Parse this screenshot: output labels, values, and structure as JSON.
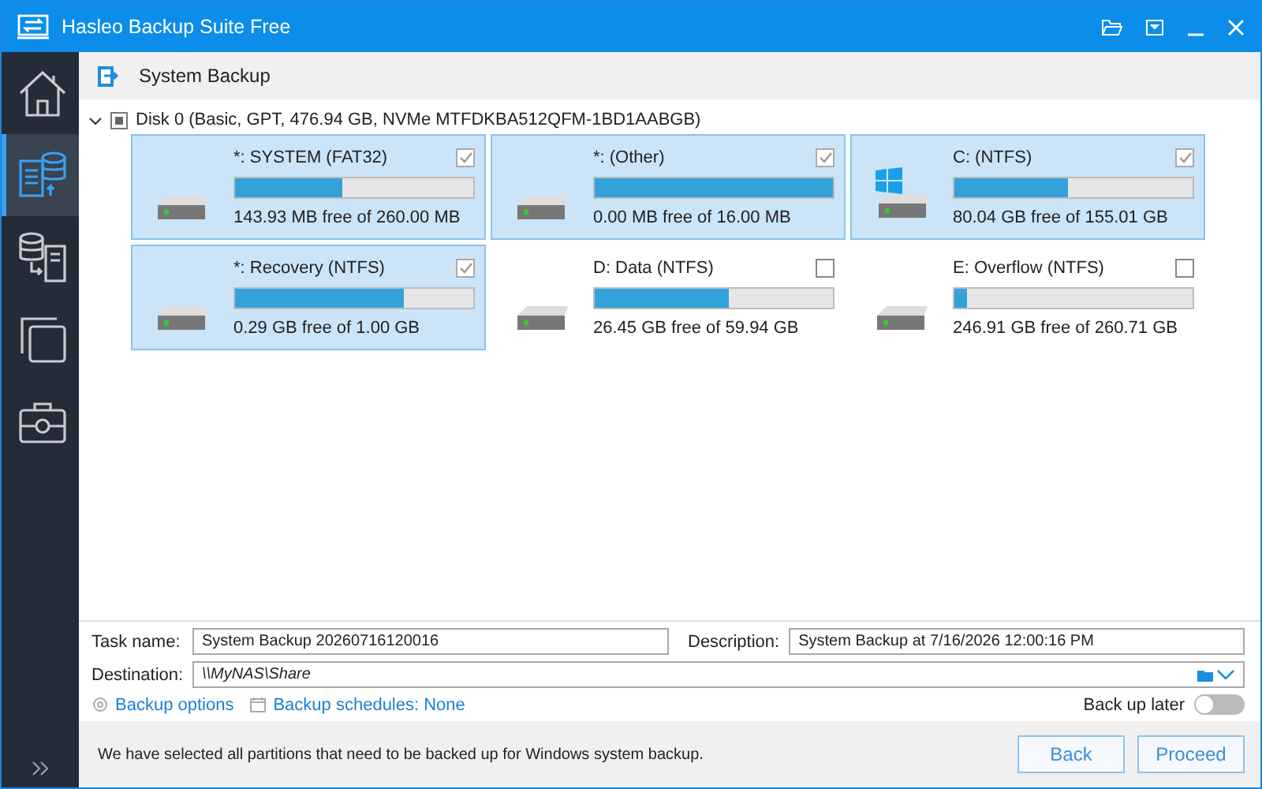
{
  "window": {
    "title": "Hasleo Backup Suite Free"
  },
  "sidebar": {
    "items": [
      {
        "kind": "home",
        "selected": false
      },
      {
        "kind": "backup",
        "selected": true
      },
      {
        "kind": "restore",
        "selected": false
      },
      {
        "kind": "clone",
        "selected": false
      },
      {
        "kind": "tools",
        "selected": false
      }
    ]
  },
  "page": {
    "title": "System Backup"
  },
  "disk": {
    "label": "Disk 0 (Basic, GPT, 476.94 GB, NVMe MTFDKBA512QFM-1BD1AABGB)",
    "expanded": true,
    "indeterminate": true
  },
  "partitions": [
    {
      "name": "*: SYSTEM (FAT32)",
      "kind": "data",
      "checked": true,
      "level": 0.45,
      "reading": "143.93 MB free of 260.00 MB"
    },
    {
      "name": "*: (Other)",
      "kind": "data",
      "checked": true,
      "level": 1.0,
      "reading": "0.00 MB free of 16.00 MB"
    },
    {
      "name": "C: (NTFS)",
      "kind": "system",
      "checked": true,
      "level": 0.48,
      "reading": "80.04 GB free of 155.01 GB"
    },
    {
      "name": "*: Recovery (NTFS)",
      "kind": "data",
      "checked": true,
      "level": 0.71,
      "reading": "0.29 GB free of 1.00 GB"
    },
    {
      "name": "D: Data (NTFS)",
      "kind": "data",
      "checked": false,
      "level": 0.56,
      "reading": "26.45 GB free of 59.94 GB"
    },
    {
      "name": "E: Overflow (NTFS)",
      "kind": "data",
      "checked": false,
      "level": 0.05,
      "reading": "246.91 GB free of 260.71 GB"
    }
  ],
  "form": {
    "task_label": "Task name:",
    "task_value": "System Backup 20260716120016",
    "description_label": "Description:",
    "description_value": "System Backup at 7/16/2026 12:00:16 PM",
    "destination_label": "Destination:",
    "destination_value": "\\\\MyNAS\\Share",
    "options_link": "Backup options",
    "schedules_link": "Backup schedules: None",
    "later": {
      "label": "Back up later",
      "on": false
    }
  },
  "footer": {
    "message": "We have selected all partitions that need to be backed up for Windows system backup.",
    "buttons": [
      "Back",
      "Proceed"
    ]
  }
}
